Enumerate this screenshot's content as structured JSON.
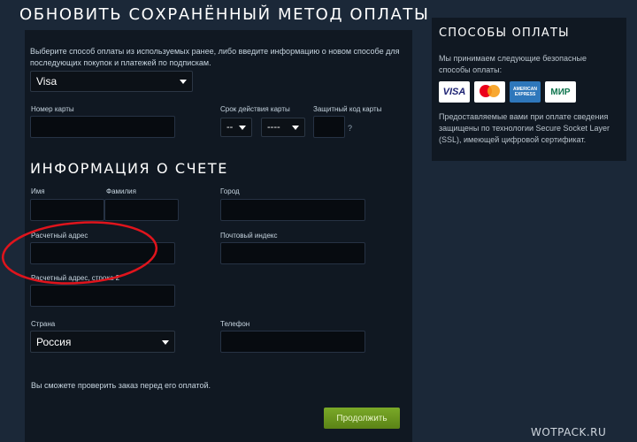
{
  "header": {
    "title": "ОБНОВИТЬ СОХРАНЁННЫЙ МЕТОД ОПЛАТЫ"
  },
  "payment": {
    "intro": "Выберите способ оплаты из используемых ранее, либо введите информацию о новом способе для последующих покупок и платежей по подпискам.",
    "method_selected": "Visa",
    "card_number_label": "Номер карты",
    "expiry_label": "Срок действия карты",
    "expiry_month": "--",
    "expiry_year": "----",
    "cvv_label": "Защитный код карты",
    "cvv_help": "?"
  },
  "billing": {
    "title": "ИНФОРМАЦИЯ О СЧЕТЕ",
    "first_name_label": "Имя",
    "last_name_label": "Фамилия",
    "city_label": "Город",
    "address_label": "Расчетный адрес",
    "zip_label": "Почтовый индекс",
    "address2_label": "Расчетный адрес, строка 2",
    "country_label": "Страна",
    "country_selected": "Россия",
    "phone_label": "Телефон",
    "note": "Вы сможете проверить заказ перед его оплатой.",
    "continue_label": "Продолжить"
  },
  "sidebar": {
    "title": "СПОСОБЫ ОПЛАТЫ",
    "accepted_text": "Мы принимаем следующие безопасные способы оплаты:",
    "cards": [
      {
        "name": "visa",
        "text": "VISA"
      },
      {
        "name": "mastercard",
        "text": ""
      },
      {
        "name": "amex",
        "text": "AMERICAN EXPRESS"
      },
      {
        "name": "mir",
        "text": "МИР"
      }
    ],
    "security_text": "Предоставляемые вами при оплате сведения защищены по технологии Secure Socket Layer (SSL), имеющей цифровой сертификат."
  },
  "watermark": "WOTPACK.RU",
  "colors": {
    "background": "#1b2838",
    "panel": "#101822",
    "input": "#070b10",
    "button": "#6b9a1f",
    "annotation": "#e0141c"
  }
}
